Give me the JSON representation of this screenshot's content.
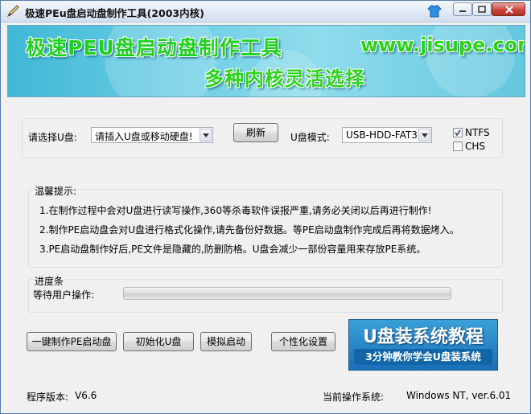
{
  "window": {
    "title": "极速PEu盘启动盘制作工具(2003内核)"
  },
  "banner": {
    "title": "极速PEU盘启动盘制作工具",
    "url": "www.jisupe.com",
    "subtitle": "多种内核灵活选择"
  },
  "usb": {
    "select_label": "请选择U盘:",
    "select_value": "请插入U盘或移动硬盘!",
    "refresh_label": "刷新",
    "mode_label": "U盘模式:",
    "mode_value": "USB-HDD-FAT32",
    "ntfs_label": "NTFS",
    "ntfs_checked": true,
    "chs_label": "CHS",
    "chs_checked": false
  },
  "tips": {
    "heading": "温馨提示:",
    "lines": [
      "1.在制作过程中会对U盘进行读写操作,360等杀毒软件误报严重,请务必关闭以后再进行制作!",
      "2.制作PE启动盘会对U盘进行格式化操作,请先备份好数据。等PE启动盘制作完成后再将数据烤入。",
      "3.PE启动盘制作好后,PE文件是隐藏的,防删防格。U盘会减少一部份容量用来存放PE系统。"
    ]
  },
  "progress": {
    "heading": "进度条",
    "status_label": "等待用户操作:",
    "value": 0
  },
  "actions": {
    "make_label": "一键制作PE启动盘",
    "init_label": "初始化U盘",
    "simulate_label": "模拟启动",
    "personalize_label": "个性化设置"
  },
  "ad": {
    "title": "U盘装系统教程",
    "subtitle": "3分钟教你学会U盘装系统"
  },
  "footer": {
    "version_label": "程序版本:",
    "version_value": "V6.6",
    "os_label": "当前操作系统:",
    "os_value": "Windows NT, ver.6.01"
  },
  "icons": {
    "app": "pen-icon",
    "skin": "tshirt-icon",
    "minimize": "minimize-icon",
    "maximize": "maximize-icon",
    "close": "close-icon",
    "dropdown": "chevron-down-icon"
  },
  "colors": {
    "banner_text": "#2bd31b",
    "close_button": "#c9463d",
    "ad_background": "#1a6fb8"
  }
}
